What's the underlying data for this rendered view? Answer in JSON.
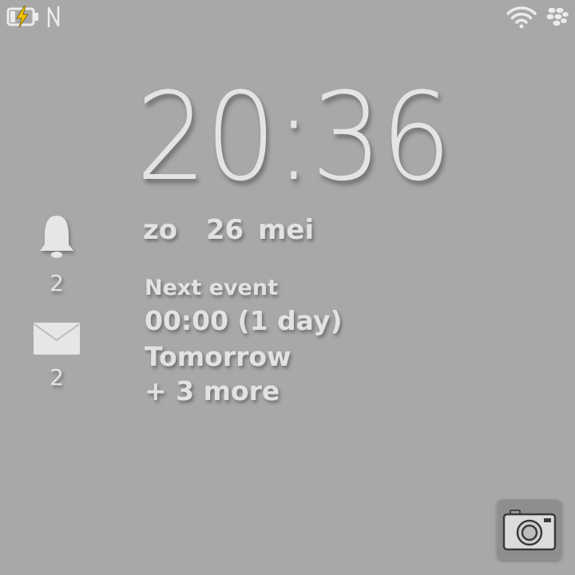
{
  "status_bar": {
    "left_icons": [
      "battery-charging-icon",
      "nfc-icon"
    ],
    "right_icons": [
      "wifi-icon",
      "blackberry-logo-icon"
    ]
  },
  "lock_screen": {
    "time": "20:36",
    "date": "zo  26 mei"
  },
  "notifications": [
    {
      "icon": "bell-icon",
      "count": "2"
    },
    {
      "icon": "mail-icon",
      "count": "2"
    }
  ],
  "next_event": {
    "title": "Next event",
    "time": "00:00 (1 day)",
    "day": "Tomorrow",
    "more": "+ 3 more"
  },
  "camera_button": {
    "icon": "camera-icon"
  },
  "colors": {
    "background": "#a8a8a8",
    "text": "#e4e4e4",
    "battery_bolt": "#f2c200"
  }
}
